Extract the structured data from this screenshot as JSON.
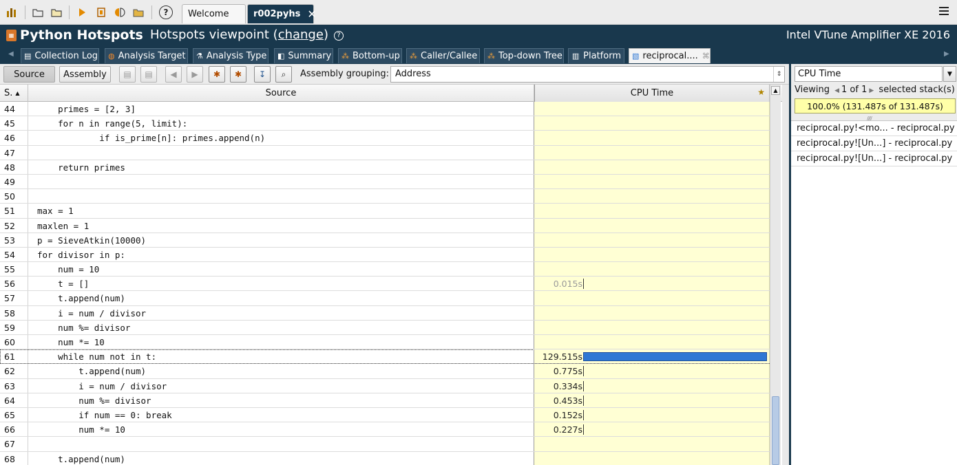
{
  "toolbar": {
    "icons": [
      "chart-icon",
      "new-project-icon",
      "open-project-icon",
      "run-icon",
      "stop-icon",
      "compare-icon",
      "open-result-icon",
      "help-icon"
    ]
  },
  "window_tabs": {
    "welcome": "Welcome",
    "result": "r002pyhs",
    "close_glyph": "✕"
  },
  "title": {
    "app": "Python Hotspots",
    "viewpoint_prefix": "Hotspots viewpoint (",
    "viewpoint_link": "change",
    "viewpoint_suffix": ")",
    "product": "Intel VTune Amplifier XE 2016"
  },
  "analysis_tabs": [
    {
      "label": "Collection Log",
      "icon": "log-icon"
    },
    {
      "label": "Analysis Target",
      "icon": "target-icon"
    },
    {
      "label": "Analysis Type",
      "icon": "analysis-type-icon"
    },
    {
      "label": "Summary",
      "icon": "summary-icon"
    },
    {
      "label": "Bottom-up",
      "icon": "bottom-up-icon"
    },
    {
      "label": "Caller/Callee",
      "icon": "caller-callee-icon"
    },
    {
      "label": "Top-down Tree",
      "icon": "top-down-icon"
    },
    {
      "label": "Platform",
      "icon": "platform-icon"
    },
    {
      "label": "reciprocal....",
      "icon": "source-file-icon",
      "active": true
    }
  ],
  "source_toolbar": {
    "source_button": "Source",
    "assembly_button": "Assembly",
    "grouping_label": "Assembly grouping:",
    "grouping_value": "Address"
  },
  "grid": {
    "col_line": "S.",
    "col_source": "Source",
    "col_cpu": "CPU Time",
    "rows": [
      {
        "line": "44",
        "code": "    primes = [2, 3]",
        "cpu": ""
      },
      {
        "line": "45",
        "code": "    for n in range(5, limit):",
        "cpu": ""
      },
      {
        "line": "46",
        "code": "            if is_prime[n]: primes.append(n)",
        "cpu": ""
      },
      {
        "line": "47",
        "code": "",
        "cpu": ""
      },
      {
        "line": "48",
        "code": "    return primes",
        "cpu": ""
      },
      {
        "line": "49",
        "code": "",
        "cpu": ""
      },
      {
        "line": "50",
        "code": "",
        "cpu": ""
      },
      {
        "line": "51",
        "code": "max = 1",
        "cpu": ""
      },
      {
        "line": "52",
        "code": "maxlen = 1",
        "cpu": ""
      },
      {
        "line": "53",
        "code": "p = SieveAtkin(10000)",
        "cpu": ""
      },
      {
        "line": "54",
        "code": "for divisor in p:",
        "cpu": ""
      },
      {
        "line": "55",
        "code": "    num = 10",
        "cpu": ""
      },
      {
        "line": "56",
        "code": "    t = []",
        "cpu": "0.015s",
        "dim": true,
        "seconds": 0.015
      },
      {
        "line": "57",
        "code": "    t.append(num)",
        "cpu": ""
      },
      {
        "line": "58",
        "code": "    i = num / divisor",
        "cpu": ""
      },
      {
        "line": "59",
        "code": "    num %= divisor",
        "cpu": ""
      },
      {
        "line": "60",
        "code": "    num *= 10",
        "cpu": ""
      },
      {
        "line": "61",
        "code": "    while num not in t:",
        "cpu": "129.515s",
        "seconds": 129.515,
        "selected": true
      },
      {
        "line": "62",
        "code": "        t.append(num)",
        "cpu": "0.775s",
        "seconds": 0.775
      },
      {
        "line": "63",
        "code": "        i = num / divisor",
        "cpu": "0.334s",
        "seconds": 0.334
      },
      {
        "line": "64",
        "code": "        num %= divisor",
        "cpu": "0.453s",
        "seconds": 0.453
      },
      {
        "line": "65",
        "code": "        if num == 0: break",
        "cpu": "0.152s",
        "seconds": 0.152
      },
      {
        "line": "66",
        "code": "        num *= 10",
        "cpu": "0.227s",
        "seconds": 0.227
      },
      {
        "line": "67",
        "code": "",
        "cpu": ""
      },
      {
        "line": "68",
        "code": "    t.append(num)",
        "cpu": ""
      }
    ],
    "max_seconds": 129.515
  },
  "stack_pane": {
    "metric": "CPU Time",
    "viewing_prefix": "Viewing",
    "viewing_count": "1 of 1",
    "viewing_suffix": "selected stack(s)",
    "percent": "100.0% (131.487s of 131.487s)",
    "items": [
      "reciprocal.py!<mo... - reciprocal.py",
      "reciprocal.py![Un...] - reciprocal.py",
      "reciprocal.py![Un...] - reciprocal.py"
    ]
  },
  "colors": {
    "title_bg": "#19384d",
    "cpu_bg": "#ffffd4",
    "bar": "#2f78d4"
  }
}
